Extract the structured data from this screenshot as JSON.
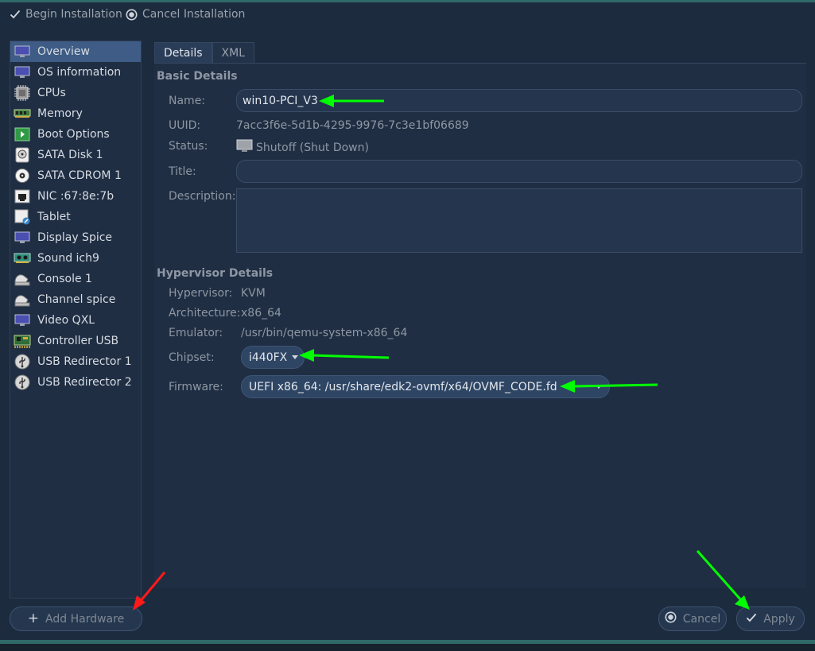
{
  "toolbar": {
    "begin_label": "Begin Installation",
    "cancel_label": "Cancel Installation"
  },
  "sidebar": {
    "items": [
      {
        "label": "Overview",
        "icon": "monitor-icon"
      },
      {
        "label": "OS information",
        "icon": "monitor-icon"
      },
      {
        "label": "CPUs",
        "icon": "cpu-chip-icon"
      },
      {
        "label": "Memory",
        "icon": "memory-module-icon"
      },
      {
        "label": "Boot Options",
        "icon": "boot-play-icon"
      },
      {
        "label": "SATA Disk 1",
        "icon": "hard-disk-icon"
      },
      {
        "label": "SATA CDROM 1",
        "icon": "cdrom-icon"
      },
      {
        "label": "NIC :67:8e:7b",
        "icon": "network-port-icon"
      },
      {
        "label": "Tablet",
        "icon": "tablet-icon"
      },
      {
        "label": "Display Spice",
        "icon": "monitor-icon"
      },
      {
        "label": "Sound ich9",
        "icon": "sound-card-icon"
      },
      {
        "label": "Console 1",
        "icon": "serial-console-icon"
      },
      {
        "label": "Channel spice",
        "icon": "serial-console-icon"
      },
      {
        "label": "Video QXL",
        "icon": "monitor-icon"
      },
      {
        "label": "Controller USB",
        "icon": "controller-card-icon"
      },
      {
        "label": "USB Redirector 1",
        "icon": "usb-icon"
      },
      {
        "label": "USB Redirector 2",
        "icon": "usb-icon"
      }
    ],
    "selected_index": 0
  },
  "tabs": [
    {
      "label": "Details",
      "active": true
    },
    {
      "label": "XML",
      "active": false
    }
  ],
  "basic": {
    "title": "Basic Details",
    "name_label": "Name:",
    "name_value": "win10-PCI_V3",
    "uuid_label": "UUID:",
    "uuid_value": "7acc3f6e-5d1b-4295-9976-7c3e1bf06689",
    "status_label": "Status:",
    "status_value": "Shutoff (Shut Down)",
    "title_label": "Title:",
    "title_value": "",
    "description_label": "Description:",
    "description_value": ""
  },
  "hypervisor": {
    "title": "Hypervisor Details",
    "hypervisor_label": "Hypervisor:",
    "hypervisor_value": "KVM",
    "architecture_label": "Architecture:",
    "architecture_value": "x86_64",
    "emulator_label": "Emulator:",
    "emulator_value": "/usr/bin/qemu-system-x86_64",
    "chipset_label": "Chipset:",
    "chipset_value": "i440FX",
    "firmware_label": "Firmware:",
    "firmware_value": "UEFI x86_64: /usr/share/edk2-ovmf/x64/OVMF_CODE.fd"
  },
  "footer": {
    "add_hardware_label": "Add Hardware",
    "cancel_label": "Cancel",
    "apply_label": "Apply"
  },
  "colors": {
    "background": "#1d2b3e",
    "selected": "#3e5c85",
    "annotation_green": "#00ff00",
    "annotation_red": "#ff1a1a"
  }
}
